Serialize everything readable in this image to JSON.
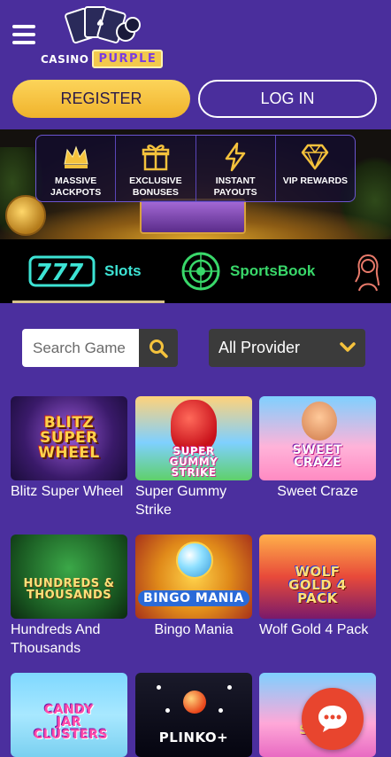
{
  "header": {
    "logo_text_casino": "CASINO",
    "logo_text_purple": "PURPLE",
    "register_label": "REGISTER",
    "login_label": "LOG IN"
  },
  "promo": {
    "features": [
      {
        "label": "MASSIVE JACKPOTS",
        "icon": "crown-icon"
      },
      {
        "label": "EXCLUSIVE BONUSES",
        "icon": "gift-icon"
      },
      {
        "label": "INSTANT PAYOUTS",
        "icon": "lightning-icon"
      },
      {
        "label": "VIP REWARDS",
        "icon": "diamond-icon"
      }
    ]
  },
  "category_tabs": {
    "items": [
      {
        "label": "Slots",
        "icon": "slots-777-icon",
        "active": true
      },
      {
        "label": "SportsBook",
        "icon": "sportsbook-icon",
        "active": false
      },
      {
        "label": "",
        "icon": "live-dealer-icon",
        "active": false
      }
    ]
  },
  "filters": {
    "search_placeholder": "Search Game",
    "provider_value": "All Provider"
  },
  "games": [
    {
      "name": "Blitz Super Wheel",
      "thumb_text": "BLITZ SUPER WHEEL"
    },
    {
      "name": "Super Gummy Strike",
      "thumb_text": "SUPER GUMMY STRIKE"
    },
    {
      "name": "Sweet Craze",
      "thumb_text": "SWEET CRAZE"
    },
    {
      "name": "Hundreds And Thousands",
      "thumb_text": "HUNDREDS & THOUSANDS"
    },
    {
      "name": "Bingo Mania",
      "thumb_text": "BINGO MANIA"
    },
    {
      "name": "Wolf Gold 4 Pack",
      "thumb_text": "WOLF GOLD 4 PACK"
    },
    {
      "name": "",
      "thumb_text": "CANDY JAR CLUSTERS"
    },
    {
      "name": "",
      "thumb_text": "PLINKO+"
    },
    {
      "name": "",
      "thumb_text": "BO SCAT"
    }
  ],
  "colors": {
    "background": "#4b2f9e",
    "register_gold": "#f5c23c",
    "slots_accent": "#3de3d4",
    "sports_accent": "#39d86a",
    "chat_button": "#e8452e"
  }
}
